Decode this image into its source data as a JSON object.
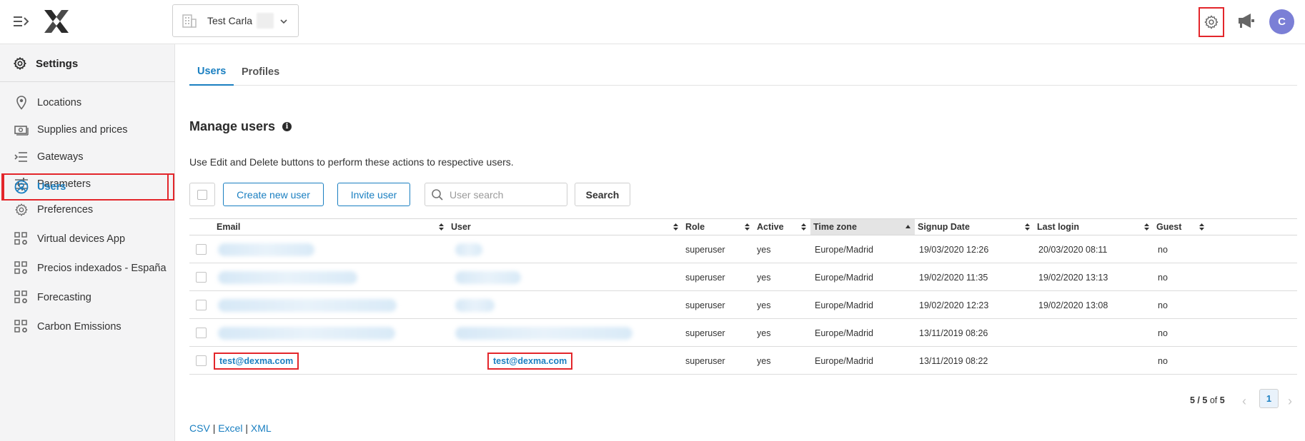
{
  "header": {
    "org_name": "Test Carla",
    "avatar_initial": "C"
  },
  "sidebar": {
    "title": "Settings",
    "items": [
      {
        "label": "Locations",
        "icon": "map-pin-icon"
      },
      {
        "label": "Supplies and prices",
        "icon": "money-icon"
      },
      {
        "label": "Gateways",
        "icon": "gateway-icon"
      },
      {
        "label": "Parameters",
        "icon": "sliders-icon"
      },
      {
        "label": "Users",
        "icon": "user-circle-icon",
        "active": true
      },
      {
        "label": "Preferences",
        "icon": "gear-icon"
      },
      {
        "label": "Virtual devices App",
        "icon": "apps-gear-icon"
      },
      {
        "label": "Precios indexados - España",
        "icon": "apps-gear-icon"
      },
      {
        "label": "Forecasting",
        "icon": "apps-gear-icon"
      },
      {
        "label": "Carbon Emissions",
        "icon": "apps-gear-icon"
      }
    ]
  },
  "tabs": [
    {
      "label": "Users",
      "active": true
    },
    {
      "label": "Profiles",
      "active": false
    }
  ],
  "main": {
    "title": "Manage users",
    "description": "Use Edit and Delete buttons to perform these actions to respective users.",
    "create_button": "Create new user",
    "invite_button": "Invite user",
    "search_placeholder": "User search",
    "search_button": "Search"
  },
  "table": {
    "columns": [
      "Email",
      "User",
      "Role",
      "Active",
      "Time zone",
      "Signup Date",
      "Last login",
      "Guest"
    ],
    "rows": [
      {
        "email": "",
        "user": "",
        "role": "superuser",
        "active": "yes",
        "timezone": "Europe/Madrid",
        "signup": "19/03/2020 12:26",
        "last_login": "20/03/2020 08:11",
        "guest": "no"
      },
      {
        "email": "",
        "user": "",
        "role": "superuser",
        "active": "yes",
        "timezone": "Europe/Madrid",
        "signup": "19/02/2020 11:35",
        "last_login": "19/02/2020 13:13",
        "guest": "no"
      },
      {
        "email": "",
        "user": "",
        "role": "superuser",
        "active": "yes",
        "timezone": "Europe/Madrid",
        "signup": "19/02/2020 12:23",
        "last_login": "19/02/2020 13:08",
        "guest": "no"
      },
      {
        "email": "",
        "user": "",
        "role": "superuser",
        "active": "yes",
        "timezone": "Europe/Madrid",
        "signup": "13/11/2019 08:26",
        "last_login": "",
        "guest": "no"
      },
      {
        "email": "test@dexma.com",
        "user": "test@dexma.com",
        "role": "superuser",
        "active": "yes",
        "timezone": "Europe/Madrid",
        "signup": "13/11/2019 08:22",
        "last_login": "",
        "guest": "no"
      }
    ]
  },
  "pagination": {
    "range": "5 / 5",
    "of_label": "of",
    "total": "5",
    "current_page": "1"
  },
  "exports": {
    "csv": "CSV",
    "excel": "Excel",
    "xml": "XML",
    "separator": "|"
  },
  "colors": {
    "accent": "#1a7fc1",
    "highlight": "#e3262b",
    "avatar": "#7b7fd6"
  }
}
